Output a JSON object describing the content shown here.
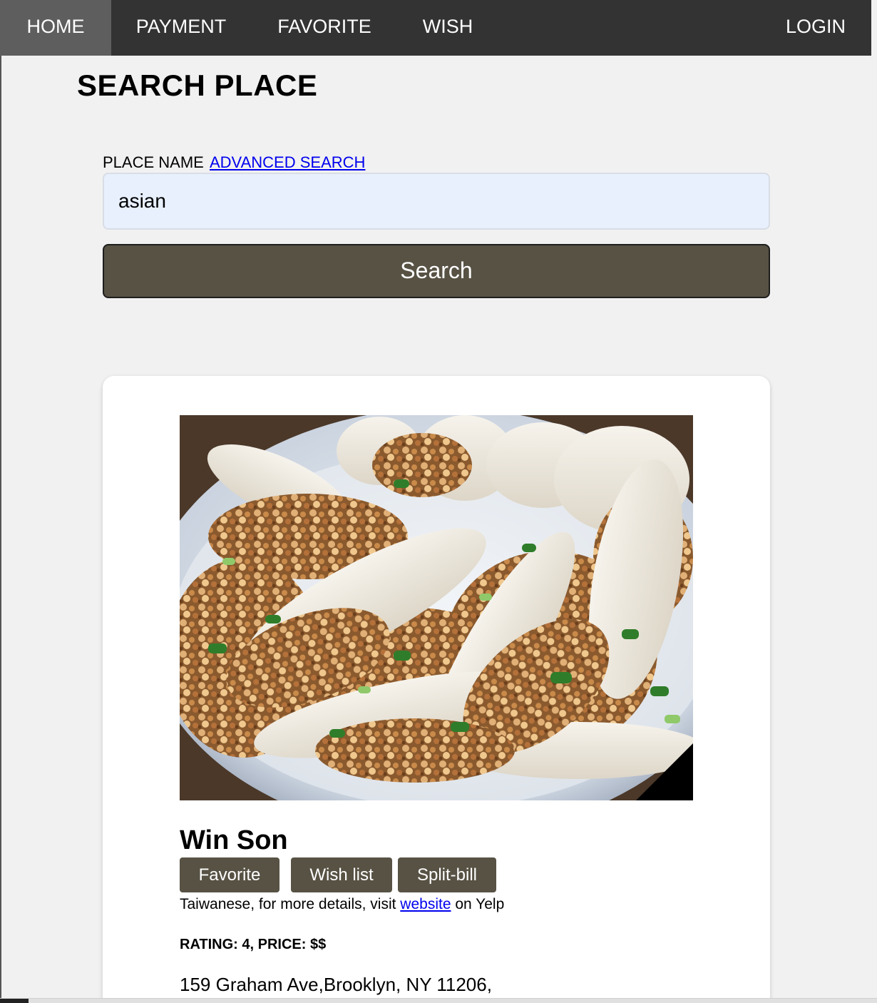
{
  "nav": {
    "items": [
      {
        "label": "HOME",
        "active": true
      },
      {
        "label": "PAYMENT"
      },
      {
        "label": "FAVORITE"
      },
      {
        "label": "WISH"
      }
    ],
    "login_label": "LOGIN"
  },
  "page": {
    "title": "SEARCH PLACE"
  },
  "search": {
    "label": "PLACE NAME",
    "advanced_link": "ADVANCED SEARCH",
    "value": "asian",
    "button_label": "Search"
  },
  "result": {
    "photo_icon": "food-photo",
    "name": "Win Son",
    "buttons": {
      "favorite": "Favorite",
      "wish": "Wish list",
      "split": "Split-bill"
    },
    "category": "Taiwanese",
    "details_prefix": ", for more details, visit ",
    "website_link": "website",
    "details_suffix": " on Yelp",
    "rating_line": "RATING: 4, PRICE: $$",
    "address": "159 Graham Ave,Brooklyn, NY 11206,"
  },
  "colors": {
    "nav_bg": "#333333",
    "nav_active": "#5e5e5e",
    "button_bg": "#575244",
    "input_bg": "#e8f0fe",
    "link": "#0000ee",
    "page_bg": "#f1f1f1"
  }
}
